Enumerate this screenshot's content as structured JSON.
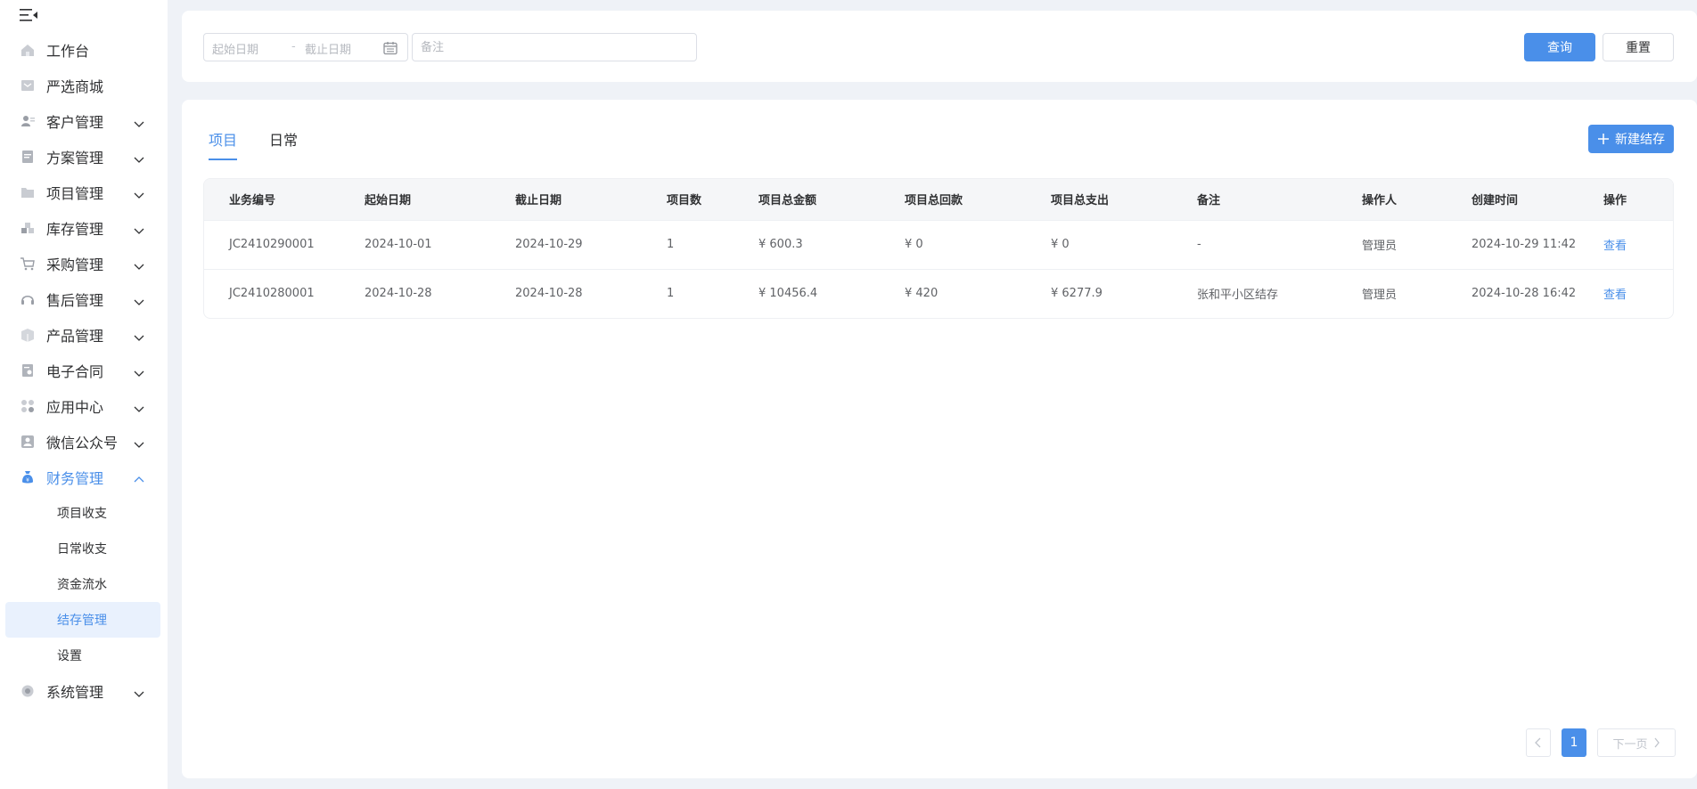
{
  "sidebar": {
    "items": [
      {
        "label": "工作台",
        "icon": "home-icon",
        "has_children": false
      },
      {
        "label": "严选商城",
        "icon": "shop-icon",
        "has_children": false
      },
      {
        "label": "客户管理",
        "icon": "customer-icon",
        "has_children": true
      },
      {
        "label": "方案管理",
        "icon": "plan-icon",
        "has_children": true
      },
      {
        "label": "项目管理",
        "icon": "folder-icon",
        "has_children": true
      },
      {
        "label": "库存管理",
        "icon": "inventory-icon",
        "has_children": true
      },
      {
        "label": "采购管理",
        "icon": "cart-icon",
        "has_children": true
      },
      {
        "label": "售后管理",
        "icon": "headset-icon",
        "has_children": true
      },
      {
        "label": "产品管理",
        "icon": "product-icon",
        "has_children": true
      },
      {
        "label": "电子合同",
        "icon": "contract-icon",
        "has_children": true
      },
      {
        "label": "应用中心",
        "icon": "apps-icon",
        "has_children": true
      },
      {
        "label": "微信公众号",
        "icon": "wechat-icon",
        "has_children": true
      },
      {
        "label": "财务管理",
        "icon": "money-bag-icon",
        "has_children": true,
        "expanded": true
      },
      {
        "label": "系统管理",
        "icon": "settings-icon",
        "has_children": true
      }
    ],
    "finance_children": [
      {
        "label": "项目收支"
      },
      {
        "label": "日常收支"
      },
      {
        "label": "资金流水"
      },
      {
        "label": "结存管理",
        "active": true
      },
      {
        "label": "设置"
      }
    ]
  },
  "filter": {
    "start_placeholder": "起始日期",
    "range_separator": "-",
    "end_placeholder": "截止日期",
    "remark_placeholder": "备注",
    "query_label": "查询",
    "reset_label": "重置"
  },
  "tabs": [
    {
      "label": "项目",
      "active": true
    },
    {
      "label": "日常",
      "active": false
    }
  ],
  "new_button_label": "新建结存",
  "table": {
    "columns": [
      "业务编号",
      "起始日期",
      "截止日期",
      "项目数",
      "项目总金额",
      "项目总回款",
      "项目总支出",
      "备注",
      "操作人",
      "创建时间",
      "操作"
    ],
    "rows": [
      [
        "JC2410290001",
        "2024-10-01",
        "2024-10-29",
        "1",
        "¥ 600.3",
        "¥ 0",
        "¥ 0",
        "-",
        "管理员",
        "2024-10-29 11:42",
        "查看"
      ],
      [
        "JC2410280001",
        "2024-10-28",
        "2024-10-28",
        "1",
        "¥ 10456.4",
        "¥ 420",
        "¥ 6277.9",
        "张和平小区结存",
        "管理员",
        "2024-10-28 16:42",
        "查看"
      ]
    ]
  },
  "pagination": {
    "current_page": "1",
    "next_label": "下一页"
  },
  "colors": {
    "accent": "#4a8fe9",
    "background": "#eff2f7"
  }
}
